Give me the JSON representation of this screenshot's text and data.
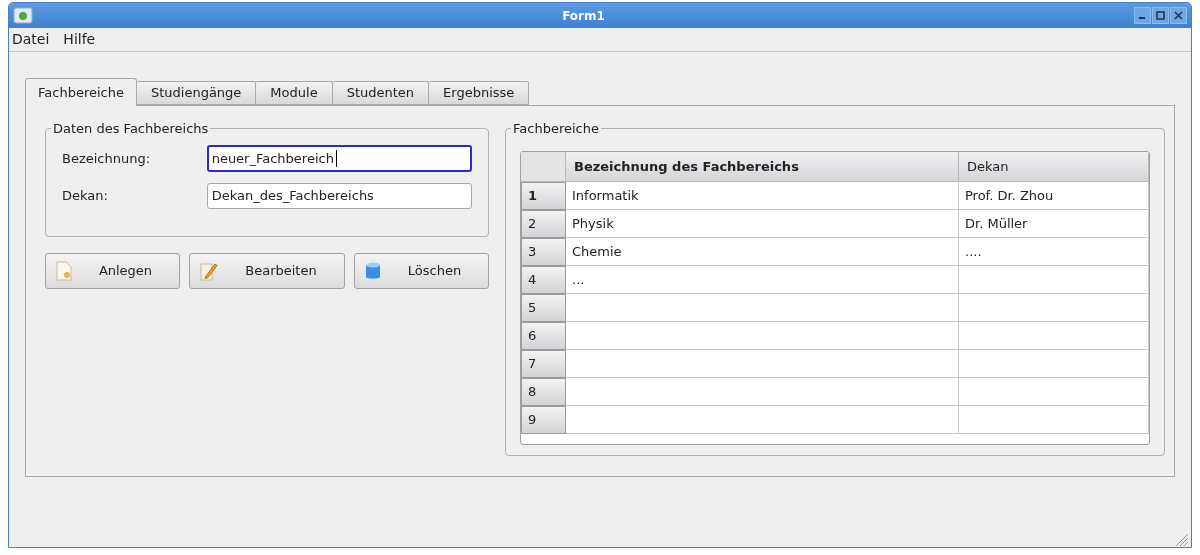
{
  "window": {
    "title": "Form1"
  },
  "menu": [
    "Datei",
    "Hilfe"
  ],
  "tabs": [
    {
      "label": "Fachbereiche",
      "selected": true
    },
    {
      "label": "Studiengänge",
      "selected": false
    },
    {
      "label": "Module",
      "selected": false
    },
    {
      "label": "Studenten",
      "selected": false
    },
    {
      "label": "Ergebnisse",
      "selected": false
    }
  ],
  "form_group": {
    "title": "Daten des Fachbereichs",
    "fields": [
      {
        "label": "Bezeichnung:",
        "value": "neuer_Fachbereich",
        "focused": true
      },
      {
        "label": "Dekan:",
        "value": "Dekan_des_Fachbereichs",
        "focused": false
      }
    ]
  },
  "buttons": [
    {
      "label": "Anlegen",
      "kind": "new"
    },
    {
      "label": "Bearbeiten",
      "kind": "edit"
    },
    {
      "label": "Löschen",
      "kind": "delete"
    }
  ],
  "table_group": {
    "title": "Fachbereiche",
    "columns": [
      "Bezeichnung des Fachbereichs",
      "Dekan"
    ],
    "rows": [
      {
        "number": "1",
        "selected": true,
        "cells": [
          "Informatik",
          "Prof. Dr. Zhou"
        ]
      },
      {
        "number": "2",
        "selected": false,
        "cells": [
          "Physik",
          "Dr. Müller"
        ]
      },
      {
        "number": "3",
        "selected": false,
        "cells": [
          "Chemie",
          "...."
        ]
      },
      {
        "number": "4",
        "selected": false,
        "cells": [
          "...",
          ""
        ]
      },
      {
        "number": "5",
        "selected": false,
        "cells": [
          "",
          ""
        ]
      },
      {
        "number": "6",
        "selected": false,
        "cells": [
          "",
          ""
        ]
      },
      {
        "number": "7",
        "selected": false,
        "cells": [
          "",
          ""
        ]
      },
      {
        "number": "8",
        "selected": false,
        "cells": [
          "",
          ""
        ]
      },
      {
        "number": "9",
        "selected": false,
        "cells": [
          "",
          ""
        ]
      }
    ]
  }
}
